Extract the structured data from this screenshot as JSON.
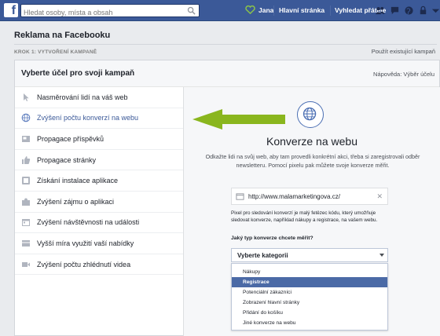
{
  "topbar": {
    "search_placeholder": "Hledat osoby, místa a obsah",
    "user_name": "Jana",
    "nav": [
      "Hlavní stránka",
      "Vyhledat přátele"
    ],
    "colors": {
      "bar": "#3b5998",
      "heart": "#8bc34a"
    }
  },
  "header": {
    "title": "Reklama na Facebooku",
    "step": "KROK 1: VYTVOŘENÍ KAMPANĚ",
    "existing_link": "Použít existující kampaň"
  },
  "panel": {
    "title": "Vyberte účel pro svoji kampaň",
    "help": "Nápověda: Výběr účelu"
  },
  "objectives": [
    {
      "label": "Nasměrování lidí na váš web",
      "icon": "cursor-icon"
    },
    {
      "label": "Zvýšení počtu konverzí na webu",
      "icon": "globe-icon",
      "active": true
    },
    {
      "label": "Propagace příspěvků",
      "icon": "post-icon"
    },
    {
      "label": "Propagace stránky",
      "icon": "like-icon"
    },
    {
      "label": "Získání instalace aplikace",
      "icon": "app-icon"
    },
    {
      "label": "Zvýšení zájmu o aplikaci",
      "icon": "puzzle-icon"
    },
    {
      "label": "Zvýšení návštěvnosti na události",
      "icon": "calendar-icon"
    },
    {
      "label": "Vyšší míra využití vaší nabídky",
      "icon": "offer-icon"
    },
    {
      "label": "Zvýšení počtu zhlédnutí videa",
      "icon": "video-icon"
    }
  ],
  "conversion": {
    "title": "Konverze na webu",
    "description": "Odkažte lidi na svůj web, aby tam provedli konkrétní akci, třeba si zaregistrovali odběr newsletteru. Pomocí pixelu pak můžete svoje konverze měřit.",
    "url": "http://www.malamarketingova.cz/",
    "pixel_note": "Pixel pro sledování konverzí je malý fetězec kódu, který umožňuje sledovat konverze, například nákupy a registrace, na vašem webu.",
    "question": "Jaký typ konverze chcete měřit?",
    "select_value": "Vyberte kategorii",
    "options": [
      "Nákupy",
      "Registrace",
      "Potenciální zákazníci",
      "Zobrazení hlavní stránky",
      "Přidání do košíku",
      "Jiné konverze na webu"
    ],
    "selected_option": "Registrace"
  },
  "annotation_arrow_color": "#8ab61e"
}
